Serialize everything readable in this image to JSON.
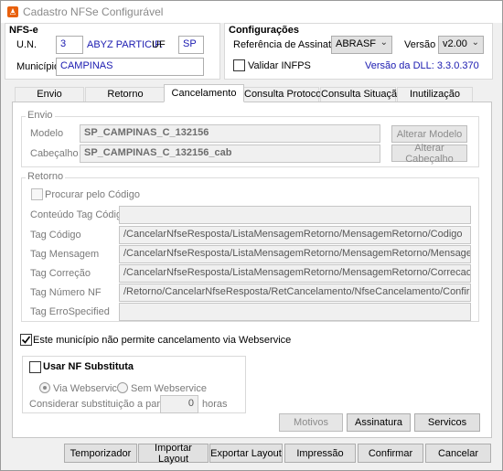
{
  "window": {
    "title": "Cadastro NFSe Configurável"
  },
  "nfse": {
    "heading": "NFS-e",
    "un_label": "U.N.",
    "un_value": "3",
    "company_name": "ABYZ PARTICIP.",
    "uf_label": "UF",
    "uf_value": "SP",
    "municipio_label": "Município",
    "municipio_value": "CAMPINAS"
  },
  "config": {
    "heading": "Configurações",
    "ref_label": "Referência de Assinatura",
    "ref_value": "ABRASF",
    "versao_label": "Versão",
    "versao_value": "v2.00",
    "validar_label": "Validar INFPS",
    "validar_checked": false,
    "dll_version": "Versão da DLL: 3.3.0.370"
  },
  "tabs": [
    {
      "label": "Envio",
      "active": false
    },
    {
      "label": "Retorno",
      "active": false
    },
    {
      "label": "Cancelamento",
      "active": true
    },
    {
      "label": "Consulta Protocolo",
      "active": false
    },
    {
      "label": "Consulta Situação",
      "active": false
    },
    {
      "label": "Inutilização",
      "active": false
    }
  ],
  "envio": {
    "legend": "Envio",
    "modelo_label": "Modelo",
    "modelo_value": "SP_CAMPINAS_C_132156",
    "cabecalho_label": "Cabeçalho",
    "cabecalho_value": "SP_CAMPINAS_C_132156_cab",
    "alterar_modelo": "Alterar Modelo",
    "alterar_cabecalho": "Alterar Cabeçalho"
  },
  "retorno": {
    "legend": "Retorno",
    "procurar_label": "Procurar pelo Código",
    "fields": [
      {
        "label": "Conteúdo Tag Código",
        "value": ""
      },
      {
        "label": "Tag Código",
        "value": "/CancelarNfseResposta/ListaMensagemRetorno/MensagemRetorno/Codigo"
      },
      {
        "label": "Tag Mensagem",
        "value": "/CancelarNfseResposta/ListaMensagemRetorno/MensagemRetorno/Mensagem"
      },
      {
        "label": "Tag Correção",
        "value": "/CancelarNfseResposta/ListaMensagemRetorno/MensagemRetorno/Correcao"
      },
      {
        "label": "Tag Número NF",
        "value": "/Retorno/CancelarNfseResposta/RetCancelamento/NfseCancelamento/Confirmacao/Pedido/In"
      },
      {
        "label": "Tag ErroSpecified",
        "value": ""
      }
    ]
  },
  "options": {
    "nao_permite_label": "Este município não permite cancelamento via Webservice",
    "nao_permite_checked": true,
    "substituta_label": "Usar NF Substituta",
    "via_webservice": "Via Webservice",
    "sem_webservice": "Sem Webservice",
    "considerar_label": "Considerar substituição a partir de",
    "horas_value": "0",
    "horas_label": "horas"
  },
  "panel_buttons": {
    "motivos": "Motivos",
    "assinatura": "Assinatura",
    "servicos": "Servicos"
  },
  "footer_buttons": {
    "temporizador": "Temporizador",
    "importar": "Importar Layout",
    "exportar": "Exportar Layout",
    "impressao": "Impressão",
    "confirmar": "Confirmar",
    "cancelar": "Cancelar"
  },
  "colors": {
    "value_text": "#1a1ab0",
    "app_icon": "#e8600c"
  }
}
